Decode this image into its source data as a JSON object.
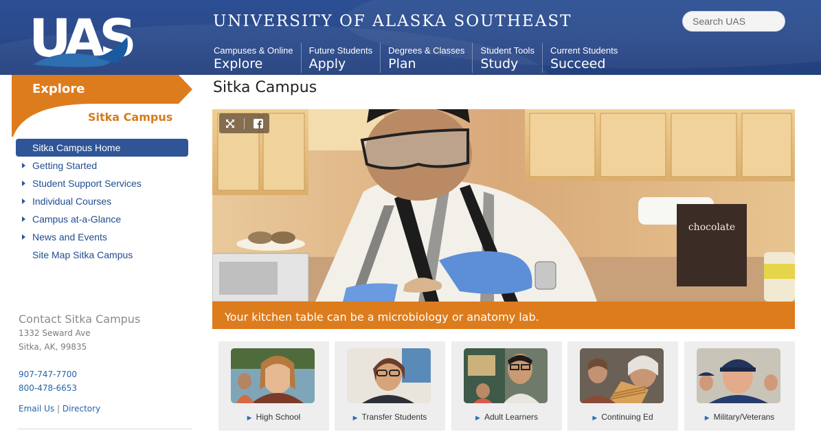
{
  "header": {
    "logo_text": "UAS",
    "site_title": "UNIVERSITY OF ALASKA SOUTHEAST",
    "search_placeholder": "Search UAS",
    "nav": [
      {
        "small": "Campuses & Online",
        "big": "Explore"
      },
      {
        "small": "Future Students",
        "big": "Apply"
      },
      {
        "small": "Degrees & Classes",
        "big": "Plan"
      },
      {
        "small": "Student Tools",
        "big": "Study"
      },
      {
        "small": "Current Students",
        "big": "Succeed"
      }
    ]
  },
  "sidebar": {
    "section": "Explore",
    "subsection": "Sitka Campus",
    "items": [
      {
        "label": "Sitka Campus Home",
        "active": true,
        "arrow": false
      },
      {
        "label": "Getting Started",
        "arrow": true
      },
      {
        "label": "Student Support Services",
        "arrow": true
      },
      {
        "label": "Individual Courses",
        "arrow": true
      },
      {
        "label": "Campus at-a-Glance",
        "arrow": true
      },
      {
        "label": "News and Events",
        "arrow": true
      },
      {
        "label": "Site Map Sitka Campus",
        "arrow": false
      }
    ],
    "contact": {
      "title": "Contact Sitka Campus",
      "address1": "1332 Seward Ave",
      "address2": "Sitka, AK, 99835",
      "phone1": "907-747-7700",
      "phone2": "800-478-6653",
      "email_label": "Email Us",
      "separator": "|",
      "directory_label": "Directory"
    }
  },
  "main": {
    "title": "Sitka Campus",
    "hero": {
      "sign_text": "chocolate",
      "caption": "Your kitchen table can be a microbiology or anatomy lab."
    },
    "cards": [
      {
        "label": "High School"
      },
      {
        "label": "Transfer Students"
      },
      {
        "label": "Adult Learners"
      },
      {
        "label": "Continuing Ed"
      },
      {
        "label": "Military/Veterans"
      }
    ]
  },
  "colors": {
    "header_blue": "#2a4a8c",
    "accent_orange": "#dd7c1d",
    "active_nav_blue": "#2f5597",
    "link_blue": "#2164a8"
  }
}
